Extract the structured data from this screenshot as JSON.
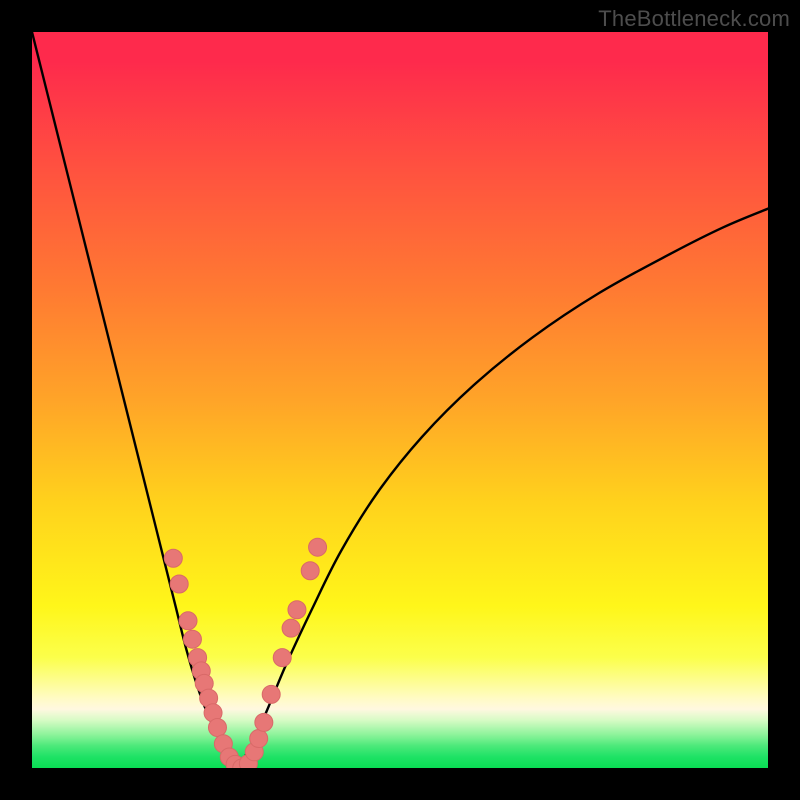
{
  "watermark": "TheBottleneck.com",
  "colors": {
    "frame": "#000000",
    "curve": "#000000",
    "marker_fill": "#e77776",
    "marker_stroke": "#d96968"
  },
  "chart_data": {
    "type": "line",
    "title": "",
    "xlabel": "",
    "ylabel": "",
    "xlim": [
      0,
      1
    ],
    "ylim": [
      0,
      1
    ],
    "note": "No axis ticks or labels are shown. Values are normalized 0–1 where x is horizontal position in the plot area and y is vertical position with 0 at the bottom (green) and 1 at the top (red). Two separate curves form a V meeting near the bottom.",
    "series": [
      {
        "name": "left-curve",
        "x": [
          0.0,
          0.03,
          0.06,
          0.09,
          0.12,
          0.15,
          0.175,
          0.195,
          0.21,
          0.225,
          0.24,
          0.255,
          0.27,
          0.28
        ],
        "y": [
          1.0,
          0.88,
          0.76,
          0.64,
          0.52,
          0.4,
          0.3,
          0.22,
          0.16,
          0.11,
          0.07,
          0.04,
          0.015,
          0.0
        ]
      },
      {
        "name": "right-curve",
        "x": [
          0.28,
          0.3,
          0.32,
          0.345,
          0.38,
          0.42,
          0.47,
          0.53,
          0.6,
          0.68,
          0.77,
          0.87,
          0.94,
          1.0
        ],
        "y": [
          0.0,
          0.035,
          0.08,
          0.14,
          0.215,
          0.295,
          0.375,
          0.45,
          0.52,
          0.585,
          0.645,
          0.7,
          0.735,
          0.76
        ]
      }
    ],
    "markers": {
      "name": "pink-dots",
      "note": "Clustered along the lower V region (below roughly y ≈ 0.30).",
      "points": [
        {
          "x": 0.192,
          "y": 0.285
        },
        {
          "x": 0.2,
          "y": 0.25
        },
        {
          "x": 0.212,
          "y": 0.2
        },
        {
          "x": 0.218,
          "y": 0.175
        },
        {
          "x": 0.225,
          "y": 0.15
        },
        {
          "x": 0.23,
          "y": 0.132
        },
        {
          "x": 0.234,
          "y": 0.115
        },
        {
          "x": 0.24,
          "y": 0.095
        },
        {
          "x": 0.246,
          "y": 0.075
        },
        {
          "x": 0.252,
          "y": 0.055
        },
        {
          "x": 0.26,
          "y": 0.033
        },
        {
          "x": 0.268,
          "y": 0.015
        },
        {
          "x": 0.276,
          "y": 0.005
        },
        {
          "x": 0.285,
          "y": 0.0
        },
        {
          "x": 0.294,
          "y": 0.006
        },
        {
          "x": 0.302,
          "y": 0.022
        },
        {
          "x": 0.308,
          "y": 0.04
        },
        {
          "x": 0.315,
          "y": 0.062
        },
        {
          "x": 0.325,
          "y": 0.1
        },
        {
          "x": 0.34,
          "y": 0.15
        },
        {
          "x": 0.352,
          "y": 0.19
        },
        {
          "x": 0.36,
          "y": 0.215
        },
        {
          "x": 0.378,
          "y": 0.268
        },
        {
          "x": 0.388,
          "y": 0.3
        }
      ]
    },
    "background_gradient_stops": [
      {
        "pos": 0.0,
        "color": "#fe2a4c"
      },
      {
        "pos": 0.18,
        "color": "#ff5040"
      },
      {
        "pos": 0.35,
        "color": "#ff7a32"
      },
      {
        "pos": 0.5,
        "color": "#ffa428"
      },
      {
        "pos": 0.64,
        "color": "#ffd21c"
      },
      {
        "pos": 0.78,
        "color": "#fff61a"
      },
      {
        "pos": 0.91,
        "color": "#fffbd0"
      },
      {
        "pos": 0.96,
        "color": "#8cf39a"
      },
      {
        "pos": 1.0,
        "color": "#0add54"
      }
    ]
  }
}
